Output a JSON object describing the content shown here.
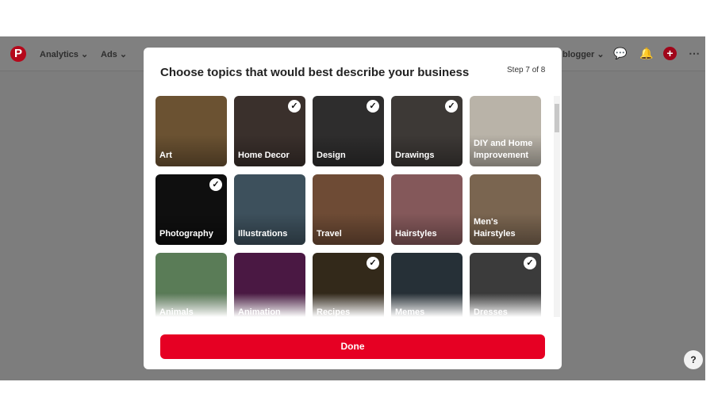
{
  "topbar": {
    "logo": "P",
    "analytics": "Analytics",
    "ads": "Ads",
    "account": "blogger",
    "chevron": "⌄"
  },
  "modal": {
    "title": "Choose topics that would best describe your business",
    "step": "Step 7 of 8",
    "done_label": "Done"
  },
  "topics": [
    {
      "label": "Art",
      "color": "#6b5232",
      "selected": false
    },
    {
      "label": "Home Decor",
      "color": "#3a302c",
      "selected": true
    },
    {
      "label": "Design",
      "color": "#2e2d2d",
      "selected": true
    },
    {
      "label": "Drawings",
      "color": "#3d3936",
      "selected": true
    },
    {
      "label": "DIY and Home Improvement",
      "color": "#b9b3a8",
      "selected": false
    },
    {
      "label": "Photography",
      "color": "#0f0f0f",
      "selected": true
    },
    {
      "label": "Illustrations",
      "color": "#3d505c",
      "selected": false
    },
    {
      "label": "Travel",
      "color": "#6e4b35",
      "selected": false
    },
    {
      "label": "Hairstyles",
      "color": "#84585a",
      "selected": false
    },
    {
      "label": "Men's Hairstyles",
      "color": "#7a6550",
      "selected": false
    },
    {
      "label": "Animals",
      "color": "#5a7c57",
      "selected": false
    },
    {
      "label": "Animation",
      "color": "#4a1843",
      "selected": false
    },
    {
      "label": "Recipes",
      "color": "#33291a",
      "selected": true
    },
    {
      "label": "Memes",
      "color": "#263037",
      "selected": false
    },
    {
      "label": "Dresses",
      "color": "#3b3b3b",
      "selected": true
    }
  ],
  "help": "?"
}
